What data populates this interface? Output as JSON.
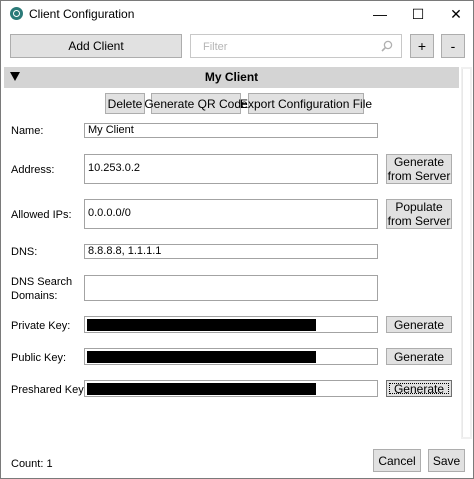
{
  "window": {
    "title": "Client Configuration",
    "minimize_glyph": "—",
    "maximize_glyph": "☐",
    "close_glyph": "✕"
  },
  "toolbar": {
    "add_client_label": "Add Client",
    "filter_placeholder": "Filter",
    "filter_value": "",
    "plus_label": "+",
    "minus_label": "-"
  },
  "client": {
    "header_title": "My Client",
    "actions": {
      "delete_label": "Delete",
      "qr_label": "Generate QR Code",
      "export_label": "Export Configuration File"
    },
    "fields": {
      "name_label": "Name:",
      "name_value": "My Client",
      "address_label": "Address:",
      "address_value": "10.253.0.2",
      "generate_from_server_label": "Generate from Server",
      "allowed_ips_label": "Allowed IPs:",
      "allowed_ips_value": "0.0.0.0/0",
      "populate_from_server_label": "Populate from Server",
      "dns_label": "DNS:",
      "dns_value": "8.8.8.8, 1.1.1.1",
      "dns_search_label": "DNS Search Domains:",
      "dns_search_value": "",
      "private_key_label": "Private Key:",
      "public_key_label": "Public Key:",
      "preshared_key_label": "Preshared Key:",
      "generate_label": "Generate"
    }
  },
  "footer": {
    "count_text": "Count: 1",
    "cancel_label": "Cancel",
    "save_label": "Save"
  },
  "colors": {
    "header_background": "#d4d4d4",
    "button_background": "#e1e1e1",
    "key_mask": "#000000",
    "app_icon": "#2b7a78"
  },
  "icons": [
    "app-logo-icon",
    "minimize-icon",
    "maximize-icon",
    "close-icon",
    "search-icon",
    "collapse-triangle-icon"
  ]
}
